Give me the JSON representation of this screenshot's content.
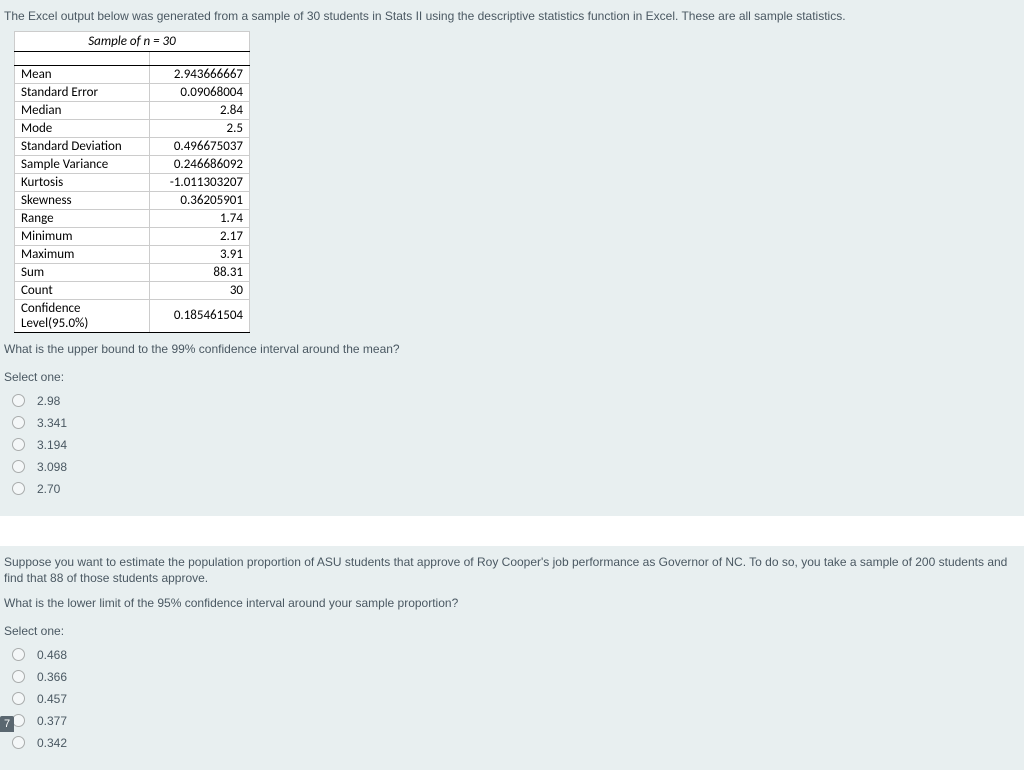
{
  "question1": {
    "intro": "The Excel output below was generated from a sample of 30 students in Stats II using the descriptive statistics function in Excel. These are all sample statistics.",
    "tableTitle": "Sample of n = 30",
    "stats": [
      {
        "label": "Mean",
        "value": "2.943666667"
      },
      {
        "label": "Standard Error",
        "value": "0.09068004"
      },
      {
        "label": "Median",
        "value": "2.84"
      },
      {
        "label": "Mode",
        "value": "2.5"
      },
      {
        "label": "Standard Deviation",
        "value": "0.496675037"
      },
      {
        "label": "Sample Variance",
        "value": "0.246686092"
      },
      {
        "label": "Kurtosis",
        "value": "-1.011303207"
      },
      {
        "label": "Skewness",
        "value": "0.36205901"
      },
      {
        "label": "Range",
        "value": "1.74"
      },
      {
        "label": "Minimum",
        "value": "2.17"
      },
      {
        "label": "Maximum",
        "value": "3.91"
      },
      {
        "label": "Sum",
        "value": "88.31"
      },
      {
        "label": "Count",
        "value": "30"
      },
      {
        "label": "Confidence Level(95.0%)",
        "value": "0.185461504"
      }
    ],
    "prompt": "What is the upper bound to the 99% confidence interval around the mean?",
    "selectLabel": "Select one:",
    "options": [
      "2.98",
      "3.341",
      "3.194",
      "3.098",
      "2.70"
    ]
  },
  "question2": {
    "intro": "Suppose you want to estimate the population proportion of ASU students that approve of Roy Cooper's job performance as Governor of NC. To do so, you take a sample of 200 students and find that 88 of those students approve.",
    "prompt": "What is the lower limit of the 95% confidence interval around your sample proportion?",
    "selectLabel": "Select one:",
    "options": [
      "0.468",
      "0.366",
      "0.457",
      "0.377",
      "0.342"
    ]
  },
  "badge": "7"
}
